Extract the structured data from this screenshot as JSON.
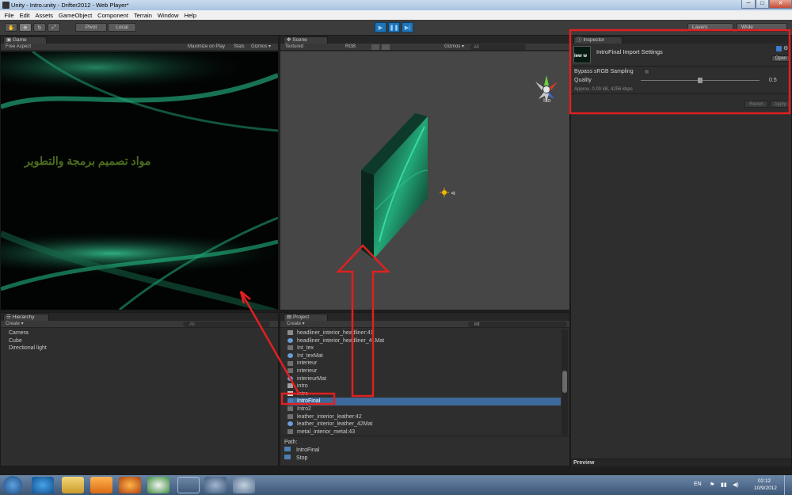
{
  "window": {
    "title": "Unity - Intro.unity - Drifter2012 - Web Player*",
    "min": "─",
    "max": "□",
    "close": "✕"
  },
  "menu": [
    "File",
    "Edit",
    "Assets",
    "GameObject",
    "Component",
    "Terrain",
    "Window",
    "Help"
  ],
  "toolbar": {
    "pivot": "Pivot",
    "local": "Local",
    "layers": "Layers",
    "layout": "Wide"
  },
  "game": {
    "tab": "Game",
    "aspect": "Free Aspect",
    "maximize": "Maximize on Play",
    "stats": "Stats",
    "gizmos": "Gizmos ▾",
    "overlay_text": "مواد  تصميم برمجة والتطوير"
  },
  "scene": {
    "tab": "Scene",
    "render_mode": "Textured",
    "color_mode": "RGB",
    "gizmos": "Gizmos ▾",
    "search": "All",
    "view": "Iso"
  },
  "hierarchy": {
    "tab": "Hierarchy",
    "create": "Create ▾",
    "search": "All",
    "items": [
      "Camera",
      "Cube",
      "Directional light"
    ]
  },
  "project": {
    "tab": "Project",
    "create": "Create ▾",
    "search": "int",
    "items": [
      {
        "name": "headliner_interior_headliner:41",
        "kind": "mesh"
      },
      {
        "name": "headliner_interior_headliner_41Mat",
        "kind": "mat"
      },
      {
        "name": "Int_tex",
        "kind": "tex"
      },
      {
        "name": "Int_texMat",
        "kind": "mat"
      },
      {
        "name": "interieur",
        "kind": "tex"
      },
      {
        "name": "interieur",
        "kind": "tex"
      },
      {
        "name": "interieurMat",
        "kind": "mat"
      },
      {
        "name": "intro",
        "kind": "file"
      },
      {
        "name": "Intro",
        "kind": "unity"
      },
      {
        "name": "IntroFinal",
        "kind": "movie",
        "selected": true
      },
      {
        "name": "Intro2",
        "kind": "tex"
      },
      {
        "name": "leather_interior_leather:42",
        "kind": "tex"
      },
      {
        "name": "leather_interior_leather_42Mat",
        "kind": "mat"
      },
      {
        "name": "metal_interior_metal:43",
        "kind": "tex"
      }
    ],
    "path_label": "Path:",
    "path_items": [
      "IntroFinal",
      "Stop"
    ]
  },
  "inspector": {
    "tab": "Inspector",
    "title": "IntroFinal Import Settings",
    "open": "Open",
    "thumb_text": "iew w",
    "bypass_label": "Bypass sRGB Sampling",
    "quality_label": "Quality",
    "quality_value": "0.5",
    "quality": 0.5,
    "approx": "Approx. 0.00 kB, 4256 kbps",
    "revert": "Revert",
    "apply": "Apply",
    "preview": "Preview"
  },
  "tray": {
    "lang": "EN",
    "time": "02:12",
    "date": "10/9/2012"
  },
  "colors": {
    "annotation": "#e02020",
    "play_blue": "#1f74b8",
    "selection": "#3d6a9b"
  }
}
